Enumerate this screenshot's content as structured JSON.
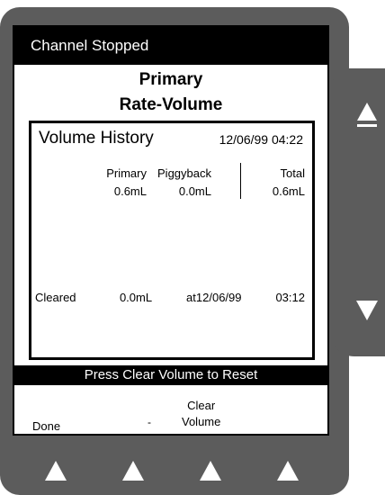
{
  "status": {
    "text": "Channel Stopped"
  },
  "header": {
    "line1": "Primary",
    "line2": "Rate-Volume"
  },
  "history": {
    "title": "Volume History",
    "datetime": "12/06/99  04:22",
    "columns": [
      {
        "label": "Primary",
        "value": "0.6mL"
      },
      {
        "label": "Piggyback",
        "value": "0.0mL"
      },
      {
        "label": "Total",
        "value": "0.6mL"
      }
    ],
    "cleared": {
      "label": "Cleared",
      "amount": "0.0mL",
      "at": "at12/06/99",
      "time": "03:12"
    }
  },
  "reset_message": "Press Clear Volume to Reset",
  "softkeys": {
    "done": "Done",
    "dot": "-",
    "clear_line1": "Clear",
    "clear_line2": "Volume"
  },
  "icons": {
    "scroll_up": "arrow-up-icon",
    "scroll_down": "arrow-down-icon",
    "softkey": "triangle-up-icon"
  },
  "colors": {
    "bezel": "#5c5c5c",
    "screen": "#ffffff",
    "bar": "#000000"
  }
}
